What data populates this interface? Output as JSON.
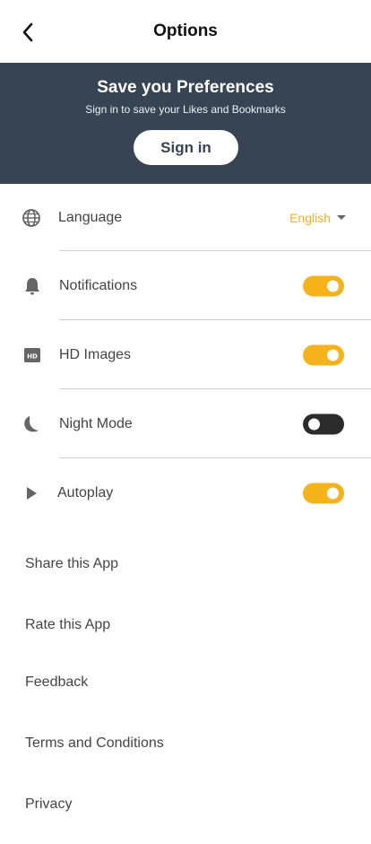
{
  "header": {
    "title": "Options",
    "back_icon": "chevron-left-icon"
  },
  "banner": {
    "title": "Save you Preferences",
    "subtitle": "Sign in to save your Likes and Bookmarks",
    "signin_label": "Sign in",
    "background": "#364453"
  },
  "settings": {
    "language": {
      "label": "Language",
      "value": "English",
      "icon": "globe-icon"
    },
    "notifications": {
      "label": "Notifications",
      "enabled": true,
      "icon": "bell-icon"
    },
    "hd_images": {
      "label": "HD Images",
      "enabled": true,
      "icon": "hd-icon"
    },
    "night_mode": {
      "label": "Night Mode",
      "enabled": false,
      "icon": "moon-icon"
    },
    "autoplay": {
      "label": "Autoplay",
      "enabled": true,
      "icon": "play-icon"
    }
  },
  "links": [
    "Share this App",
    "Rate this App",
    "Feedback",
    "Terms and Conditions",
    "Privacy"
  ],
  "colors": {
    "accent": "#f6b21a",
    "toggle_off": "#2b2b2b",
    "banner": "#364453"
  }
}
